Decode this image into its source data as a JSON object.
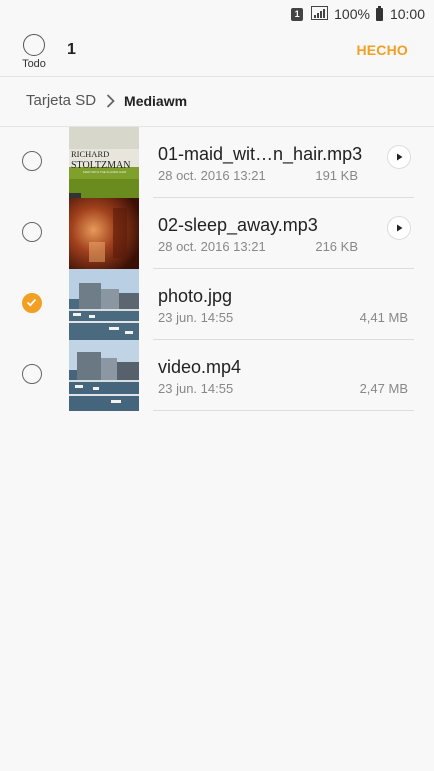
{
  "status": {
    "sim": "1",
    "battery": "100%",
    "time": "10:00"
  },
  "header": {
    "select_all_label": "Todo",
    "selected_count": "1",
    "done_label": "HECHO"
  },
  "breadcrumb": {
    "root": "Tarjeta SD",
    "current": "Mediawm"
  },
  "files": [
    {
      "name": "01-maid_wit…n_hair.mp3",
      "date": "28 oct. 2016 13:21",
      "size": "191 KB",
      "checked": false,
      "playable": true
    },
    {
      "name": "02-sleep_away.mp3",
      "date": "28 oct. 2016 13:21",
      "size": "216 KB",
      "checked": false,
      "playable": true
    },
    {
      "name": "photo.jpg",
      "date": "23 jun. 14:55",
      "size": "4,41 MB",
      "checked": true,
      "playable": false
    },
    {
      "name": "video.mp4",
      "date": "23 jun. 14:55",
      "size": "2,47 MB",
      "checked": false,
      "playable": false
    }
  ],
  "album_art": {
    "artist_line1": "RICHARD",
    "artist_line2": "STOLTZMAN",
    "subtitle": "MAID WITH THE FLAXEN HAIR"
  },
  "colors": {
    "accent": "#f2a023"
  }
}
